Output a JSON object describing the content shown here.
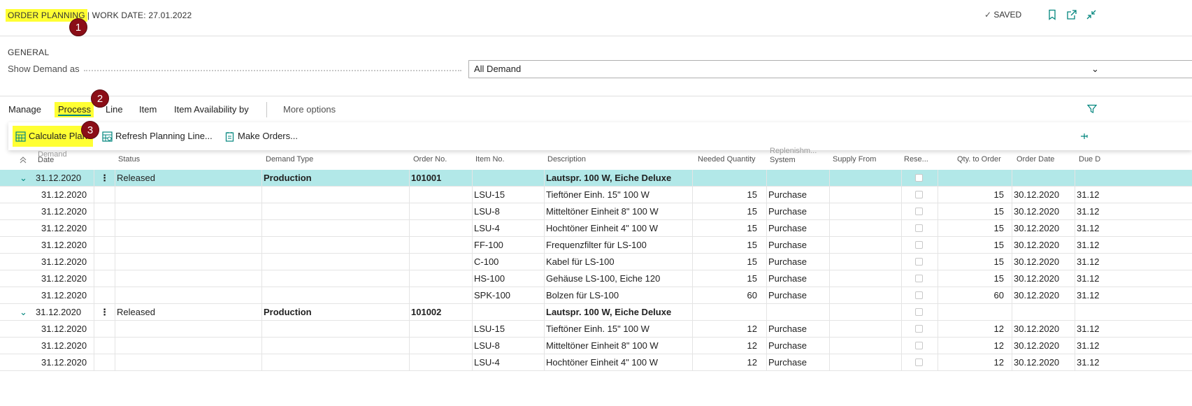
{
  "header": {
    "page_title": "ORDER PLANNING",
    "work_date": "| WORK DATE: 27.01.2022",
    "saved_label": "SAVED",
    "icons": [
      "bookmark-icon",
      "open-new-window-icon",
      "collapse-icon"
    ]
  },
  "annotations": [
    "1",
    "2",
    "3"
  ],
  "general": {
    "section_title": "GENERAL",
    "show_demand_label": "Show Demand as",
    "show_demand_value": "All Demand"
  },
  "action_bar": {
    "tabs": [
      "Manage",
      "Process",
      "Line",
      "Item",
      "Item Availability by"
    ],
    "active_tab": "Process",
    "more_options": "More options"
  },
  "process_actions": {
    "calculate_plan": "Calculate Plan",
    "refresh_planning": "Refresh Planning Line...",
    "make_orders": "Make Orders..."
  },
  "columns": {
    "demand_date_1": "Demand",
    "demand_date_2": "Date",
    "status": "Status",
    "demand_type": "Demand Type",
    "order_no": "Order No.",
    "item_no": "Item No.",
    "description": "Description",
    "needed_qty": "Needed Quantity",
    "replenish_1": "Replenishm...",
    "replenish_2": "System",
    "supply_from": "Supply From",
    "reserve": "Rese...",
    "qty_to_order": "Qty. to Order",
    "order_date": "Order Date",
    "due_date": "Due D"
  },
  "rows": [
    {
      "kind": "group",
      "date": "31.12.2020",
      "status": "Released",
      "type": "Production",
      "order": "101001",
      "desc": "Lautspr. 100 W, Eiche Deluxe",
      "selected": true
    },
    {
      "kind": "line",
      "date": "31.12.2020",
      "item": "LSU-15",
      "desc": "Tieftöner Einh. 15\" 100 W",
      "needed": "15",
      "repl": "Purchase",
      "qty": "15",
      "odate": "30.12.2020",
      "due": "31.12"
    },
    {
      "kind": "line",
      "date": "31.12.2020",
      "item": "LSU-8",
      "desc": "Mitteltöner Einheit 8\" 100 W",
      "needed": "15",
      "repl": "Purchase",
      "qty": "15",
      "odate": "30.12.2020",
      "due": "31.12"
    },
    {
      "kind": "line",
      "date": "31.12.2020",
      "item": "LSU-4",
      "desc": "Hochtöner Einheit 4\" 100 W",
      "needed": "15",
      "repl": "Purchase",
      "qty": "15",
      "odate": "30.12.2020",
      "due": "31.12"
    },
    {
      "kind": "line",
      "date": "31.12.2020",
      "item": "FF-100",
      "desc": "Frequenzfilter für LS-100",
      "needed": "15",
      "repl": "Purchase",
      "qty": "15",
      "odate": "30.12.2020",
      "due": "31.12"
    },
    {
      "kind": "line",
      "date": "31.12.2020",
      "item": "C-100",
      "desc": "Kabel für LS-100",
      "needed": "15",
      "repl": "Purchase",
      "qty": "15",
      "odate": "30.12.2020",
      "due": "31.12"
    },
    {
      "kind": "line",
      "date": "31.12.2020",
      "item": "HS-100",
      "desc": "Gehäuse LS-100, Eiche 120",
      "needed": "15",
      "repl": "Purchase",
      "qty": "15",
      "odate": "30.12.2020",
      "due": "31.12"
    },
    {
      "kind": "line",
      "date": "31.12.2020",
      "item": "SPK-100",
      "desc": "Bolzen für LS-100",
      "needed": "60",
      "repl": "Purchase",
      "qty": "60",
      "odate": "30.12.2020",
      "due": "31.12"
    },
    {
      "kind": "group",
      "date": "31.12.2020",
      "status": "Released",
      "type": "Production",
      "order": "101002",
      "desc": "Lautspr. 100 W, Eiche Deluxe",
      "selected": false
    },
    {
      "kind": "line",
      "date": "31.12.2020",
      "item": "LSU-15",
      "desc": "Tieftöner Einh. 15\" 100 W",
      "needed": "12",
      "repl": "Purchase",
      "qty": "12",
      "odate": "30.12.2020",
      "due": "31.12"
    },
    {
      "kind": "line",
      "date": "31.12.2020",
      "item": "LSU-8",
      "desc": "Mitteltöner Einheit 8\" 100 W",
      "needed": "12",
      "repl": "Purchase",
      "qty": "12",
      "odate": "30.12.2020",
      "due": "31.12"
    },
    {
      "kind": "line",
      "date": "31.12.2020",
      "item": "LSU-4",
      "desc": "Hochtöner Einheit 4\" 100 W",
      "needed": "12",
      "repl": "Purchase",
      "qty": "12",
      "odate": "30.12.2020",
      "due": "31.12"
    }
  ],
  "colors": {
    "accent": "#00857d",
    "highlight": "#ffff33",
    "badge": "#8b0e17",
    "selected_row": "#b2e8e8"
  }
}
